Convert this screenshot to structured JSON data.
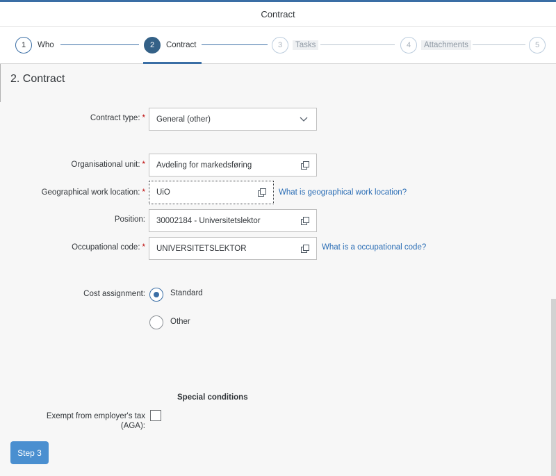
{
  "window": {
    "title": "Contract"
  },
  "wizard": {
    "steps": [
      {
        "number": "1",
        "label": "Who",
        "state": "completed"
      },
      {
        "number": "2",
        "label": "Contract",
        "state": "active"
      },
      {
        "number": "3",
        "label": "Tasks",
        "state": "disabled"
      },
      {
        "number": "4",
        "label": "Attachments",
        "state": "disabled"
      },
      {
        "number": "5",
        "label": "",
        "state": "disabled"
      }
    ]
  },
  "section": {
    "title": "2. Contract"
  },
  "form": {
    "contract_type": {
      "label": "Contract type:",
      "value": "General (other)",
      "required": "*"
    },
    "org_unit": {
      "label": "Organisational unit:",
      "value": "Avdeling for markedsføring",
      "required": "*"
    },
    "geo_location": {
      "label": "Geographical work location:",
      "value": "UiO",
      "required": "*",
      "help_link": "What is geographical work location?"
    },
    "position": {
      "label": "Position:",
      "value": "30002184 - Universitetslektor"
    },
    "occupational_code": {
      "label": "Occupational code:",
      "value": "UNIVERSITETSLEKTOR",
      "required": "*",
      "help_link": "What is a occupational code?"
    },
    "cost_assignment": {
      "label": "Cost assignment:",
      "options": [
        {
          "label": "Standard",
          "selected": true
        },
        {
          "label": "Other",
          "selected": false
        }
      ]
    },
    "special_conditions": {
      "heading": "Special conditions",
      "aga_label_line1": "Exempt from employer's tax",
      "aga_label_line2": "(AGA):",
      "aga_checked": false
    }
  },
  "footer": {
    "next_button": "Step 3"
  },
  "colors": {
    "accent": "#3a6ea5",
    "link": "#2a6db5",
    "required": "#bb0000",
    "button": "#4a8fd0"
  },
  "icons": {
    "value_help": "value-help-icon",
    "dropdown": "chevron-down-icon"
  }
}
